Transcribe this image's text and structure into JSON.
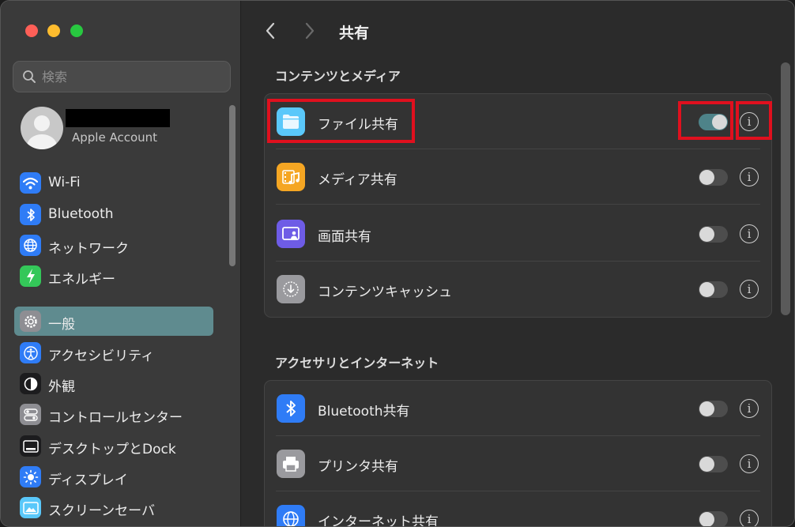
{
  "sidebar": {
    "search_placeholder": "検索",
    "account_label": "Apple Account",
    "items": [
      {
        "label": "Wi-Fi",
        "icon": "wifi-icon",
        "color": "#2f7cf6"
      },
      {
        "label": "Bluetooth",
        "icon": "bluetooth-icon",
        "color": "#2f7cf6"
      },
      {
        "label": "ネットワーク",
        "icon": "globe-icon",
        "color": "#2f7cf6"
      },
      {
        "label": "エネルギー",
        "icon": "bolt-icon",
        "color": "#34c759"
      },
      {
        "label": "一般",
        "icon": "gear-icon",
        "color": "#8e8e93",
        "selected": true
      },
      {
        "label": "アクセシビリティ",
        "icon": "accessibility-icon",
        "color": "#2f7cf6"
      },
      {
        "label": "外観",
        "icon": "appearance-icon",
        "color": "#1c1c1e"
      },
      {
        "label": "コントロールセンター",
        "icon": "control-center-icon",
        "color": "#8e8e93"
      },
      {
        "label": "デスクトップとDock",
        "icon": "dock-icon",
        "color": "#1c1c1e"
      },
      {
        "label": "ディスプレイ",
        "icon": "display-brightness-icon",
        "color": "#2f7cf6"
      },
      {
        "label": "スクリーンセーバ",
        "icon": "screensaver-icon",
        "color": "#5ac8fa"
      }
    ]
  },
  "main": {
    "title": "共有",
    "sections": [
      {
        "title": "コンテンツとメディア",
        "rows": [
          {
            "label": "ファイル共有",
            "icon": "folder-icon",
            "color": "#5ac8fa",
            "on": true
          },
          {
            "label": "メディア共有",
            "icon": "media-icon",
            "color": "#f5a623",
            "on": false
          },
          {
            "label": "画面共有",
            "icon": "screen-share-icon",
            "color": "#6e5ce6",
            "on": false
          },
          {
            "label": "コンテンツキャッシュ",
            "icon": "download-icon",
            "color": "#8e8e93",
            "on": false
          }
        ]
      },
      {
        "title": "アクセサリとインターネット",
        "rows": [
          {
            "label": "Bluetooth共有",
            "icon": "bluetooth-icon",
            "color": "#2f7cf6",
            "on": false
          },
          {
            "label": "プリンタ共有",
            "icon": "printer-icon",
            "color": "#8e8e93",
            "on": false
          },
          {
            "label": "インターネット共有",
            "icon": "globe-icon",
            "color": "#2f7cf6",
            "on": false
          }
        ]
      }
    ]
  }
}
